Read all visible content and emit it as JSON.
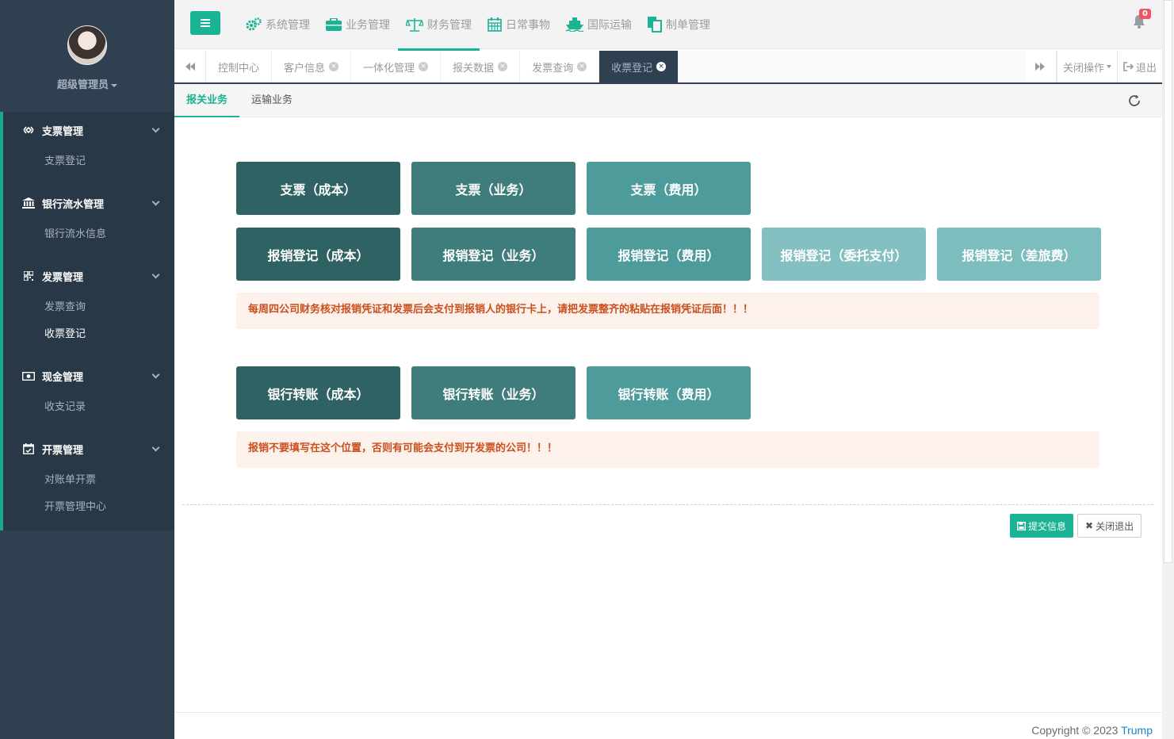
{
  "profile": {
    "name": "超级管理员"
  },
  "sidebar": {
    "groups": [
      {
        "icon": "diamond-outline-icon",
        "label": "支票管理",
        "items": [
          {
            "label": "支票登记"
          }
        ]
      },
      {
        "icon": "bank-icon",
        "label": "银行流水管理",
        "items": [
          {
            "label": "银行流水信息"
          }
        ]
      },
      {
        "icon": "qrcode-icon",
        "label": "发票管理",
        "items": [
          {
            "label": "发票查询"
          },
          {
            "label": "收票登记",
            "active": true
          }
        ]
      },
      {
        "icon": "money-icon",
        "label": "现金管理",
        "items": [
          {
            "label": "收支记录"
          }
        ]
      },
      {
        "icon": "calendar-check-icon",
        "label": "开票管理",
        "items": [
          {
            "label": "对账单开票"
          },
          {
            "label": "开票管理中心"
          }
        ]
      }
    ]
  },
  "topnav": {
    "items": [
      {
        "icon": "cogs-icon",
        "label": "系统管理"
      },
      {
        "icon": "briefcase-icon",
        "label": "业务管理"
      },
      {
        "icon": "balance-scale-icon",
        "label": "财务管理",
        "active": true
      },
      {
        "icon": "calendar-icon",
        "label": "日常事物"
      },
      {
        "icon": "ship-icon",
        "label": "国际运输"
      },
      {
        "icon": "file-copy-icon",
        "label": "制单管理"
      }
    ],
    "notification_count": "0"
  },
  "tabs": {
    "items": [
      {
        "label": "控制中心",
        "closable": false
      },
      {
        "label": "客户信息",
        "closable": true
      },
      {
        "label": "一体化管理",
        "closable": true
      },
      {
        "label": "报关数据",
        "closable": true
      },
      {
        "label": "发票查询",
        "closable": true
      },
      {
        "label": "收票登记",
        "closable": true,
        "active": true
      }
    ],
    "close_ops_label": "关闭操作",
    "logout_label": "退出"
  },
  "subtabs": [
    {
      "label": "报关业务",
      "active": true
    },
    {
      "label": "运输业务"
    }
  ],
  "cheque_buttons": [
    "支票（成本）",
    "支票（业务）",
    "支票（费用）"
  ],
  "reimburse_buttons": [
    "报销登记（成本）",
    "报销登记（业务）",
    "报销登记（费用）",
    "报销登记（委托支付）",
    "报销登记（差旅费）"
  ],
  "notice1": "每周四公司财务核对报销凭证和发票后会支付到报销人的银行卡上，请把发票整齐的粘贴在报销凭证后面！！！",
  "transfer_buttons": [
    "银行转账（成本）",
    "银行转账（业务）",
    "银行转账（费用）"
  ],
  "notice2": "报销不要填写在这个位置，否则有可能会支付到开发票的公司！！！",
  "actions": {
    "submit_label": "提交信息",
    "close_label": "关闭退出"
  },
  "footer": {
    "copyright": "Copyright © 2023",
    "brand": "Trump"
  },
  "colors": {
    "accent": "#1ab394",
    "sidebar": "#2f4050",
    "notice_text": "#c9501c",
    "notice_bg": "#fdf1ec"
  }
}
